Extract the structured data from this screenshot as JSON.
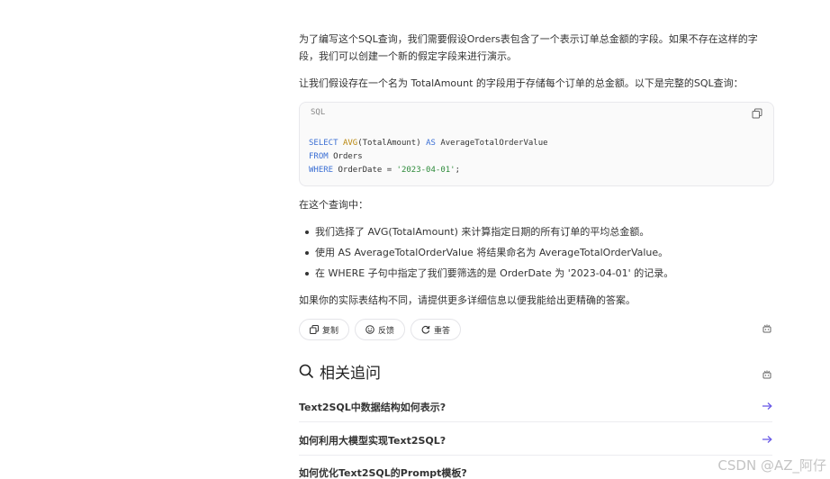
{
  "answer": {
    "paragraph1": "为了编写这个SQL查询，我们需要假设Orders表包含了一个表示订单总金额的字段。如果不存在这样的字段，我们可以创建一个新的假定字段来进行演示。",
    "paragraph2": "让我们假设存在一个名为 TotalAmount 的字段用于存储每个订单的总金额。以下是完整的SQL查询：",
    "code": {
      "language": "SQL",
      "line1": {
        "kw1": "SELECT",
        "fn": "AVG",
        "rest": "(TotalAmount) ",
        "kw2": "AS",
        "tail": " AverageTotalOrderValue"
      },
      "line2": {
        "kw": "FROM",
        "rest": " Orders"
      },
      "line3": {
        "kw": "WHERE",
        "rest": " OrderDate = ",
        "str": "'2023-04-01'",
        "end": ";"
      }
    },
    "paragraph3": "在这个查询中：",
    "bullets": [
      "我们选择了 AVG(TotalAmount) 来计算指定日期的所有订单的平均总金额。",
      "使用 AS AverageTotalOrderValue 将结果命名为 AverageTotalOrderValue。",
      "在 WHERE 子句中指定了我们要筛选的是 OrderDate 为 '2023-04-01' 的记录。"
    ],
    "paragraph4": "如果你的实际表结构不同，请提供更多详细信息以便我能给出更精确的答案。"
  },
  "actions": {
    "copy_label": "复制",
    "feedback_label": "反馈",
    "retry_label": "重答"
  },
  "related": {
    "title": "相关追问",
    "items": [
      "Text2SQL中数据结构如何表示?",
      "如何利用大模型实现Text2SQL?",
      "如何优化Text2SQL的Prompt模板?"
    ]
  },
  "watermark": "CSDN @AZ_阿仔",
  "icons": [
    "copy-icon",
    "smile-icon",
    "refresh-icon",
    "bot-icon",
    "search-icon",
    "arrow-right-icon"
  ],
  "colors": {
    "keyword": "#3b6fd4",
    "function": "#b8860b",
    "string": "#2e8b3b",
    "arrow": "#6b5ce7"
  }
}
